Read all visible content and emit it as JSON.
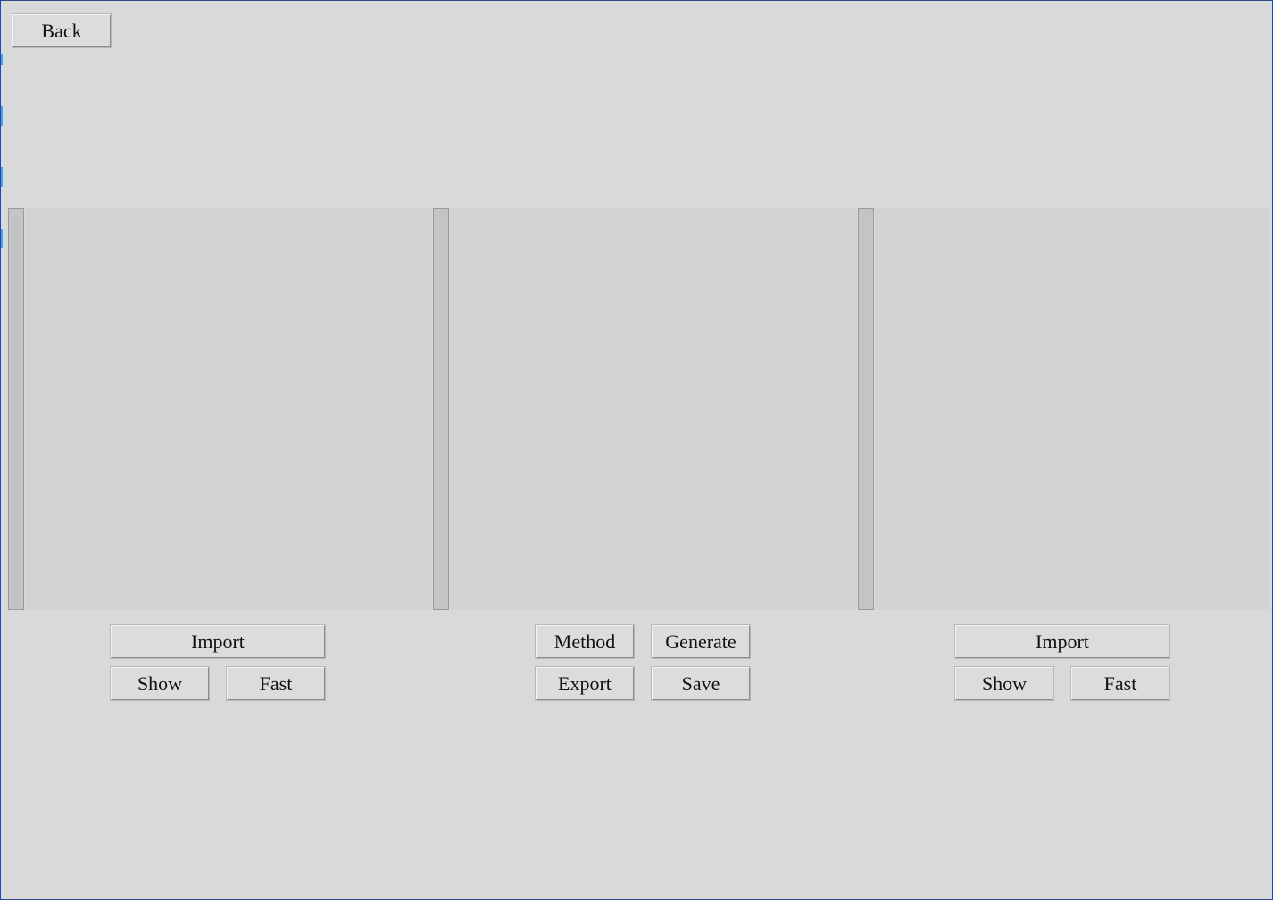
{
  "toolbar": {
    "back_label": "Back"
  },
  "left_panel": {
    "import_label": "Import",
    "show_label": "Show",
    "fast_label": "Fast"
  },
  "center_panel": {
    "method_label": "Method",
    "generate_label": "Generate",
    "export_label": "Export",
    "save_label": "Save"
  },
  "right_panel": {
    "import_label": "Import",
    "show_label": "Show",
    "fast_label": "Fast"
  }
}
